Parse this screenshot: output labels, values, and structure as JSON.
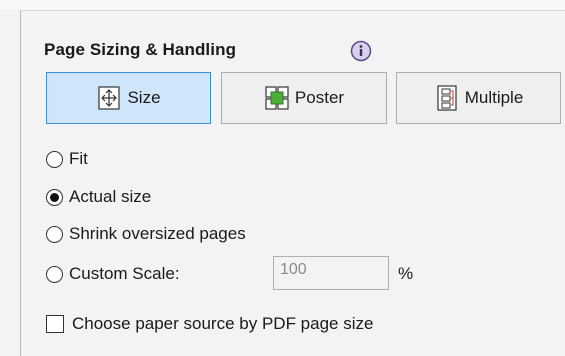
{
  "section": {
    "title": "Page Sizing & Handling"
  },
  "info_icon": "info-icon",
  "mode_buttons": [
    {
      "label": "Size",
      "icon": "size-icon",
      "selected": true
    },
    {
      "label": "Poster",
      "icon": "poster-icon",
      "selected": false
    },
    {
      "label": "Multiple",
      "icon": "multiple-pages-icon",
      "selected": false
    }
  ],
  "scaling_options": [
    {
      "label": "Fit",
      "checked": false
    },
    {
      "label": "Actual size",
      "checked": true
    },
    {
      "label": "Shrink oversized pages",
      "checked": false
    },
    {
      "label": "Custom Scale:",
      "checked": false
    }
  ],
  "custom_scale": {
    "value": "100",
    "unit": "%"
  },
  "paper_source": {
    "label": "Choose paper source by PDF page size",
    "checked": false
  },
  "colors": {
    "selected_bg": "#cfe5f9",
    "selected_border": "#3c8fd9",
    "panel_bg": "#f3f3f3"
  }
}
